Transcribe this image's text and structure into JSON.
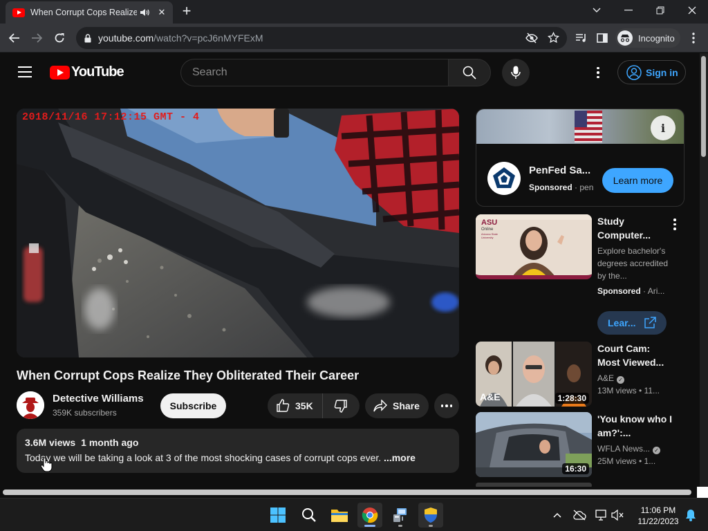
{
  "browser": {
    "tab_title": "When Corrupt Cops Realize They Obliterated Their Career - YouTube",
    "tab_title_visible": "When Corrupt Cops Realize",
    "url_host": "youtube.com",
    "url_path": "/watch?v=pcJ6nMYFExM",
    "incognito_label": "Incognito"
  },
  "header": {
    "logo_text": "YouTube",
    "search_placeholder": "Search",
    "signin_label": "Sign in"
  },
  "player": {
    "timestamp_overlay": "2018/11/16  17:12:15 GMT - 4"
  },
  "video": {
    "title": "When Corrupt Cops Realize They Obliterated Their Career",
    "channel": "Detective Williams",
    "subscribers": "359K subscribers",
    "subscribe_label": "Subscribe",
    "likes": "35K",
    "share_label": "Share",
    "views": "3.6M views",
    "age": "1 month ago",
    "description": "Today we will be taking a look at 3 of the most shocking cases of corrupt cops ever.",
    "more_label": "...more"
  },
  "ad": {
    "name": "PenFed Sa...",
    "sponsored": "Sponsored",
    "domain": "pen",
    "dot": "·",
    "learn_more": "Learn more",
    "info_icon": "i"
  },
  "recommendations": [
    {
      "title": "Study Computer...",
      "desc": "Explore bachelor's degrees accredited by the...",
      "sponsored": "Sponsored",
      "advertiser": "Ari...",
      "learn_label": "Lear...",
      "thumb_logo": "ASU",
      "thumb_logo_sub": "Online",
      "thumb_logo_sub2": "Arizona State University"
    },
    {
      "title": "Court Cam: Most Viewed...",
      "channel": "A&E",
      "meta": "13M views  •  11...",
      "duration": "1:28:30",
      "thumb_logo": "A&E"
    },
    {
      "title": "'You know who I am?':...",
      "channel": "WFLA News...",
      "meta": "25M views  •  1...",
      "duration": "16:30"
    }
  ],
  "taskbar": {
    "time": "11:06 PM",
    "date": "11/22/2023"
  },
  "colors": {
    "youtube_red": "#ff0000",
    "link_blue": "#3ea6ff",
    "background": "#0f0f0f"
  }
}
